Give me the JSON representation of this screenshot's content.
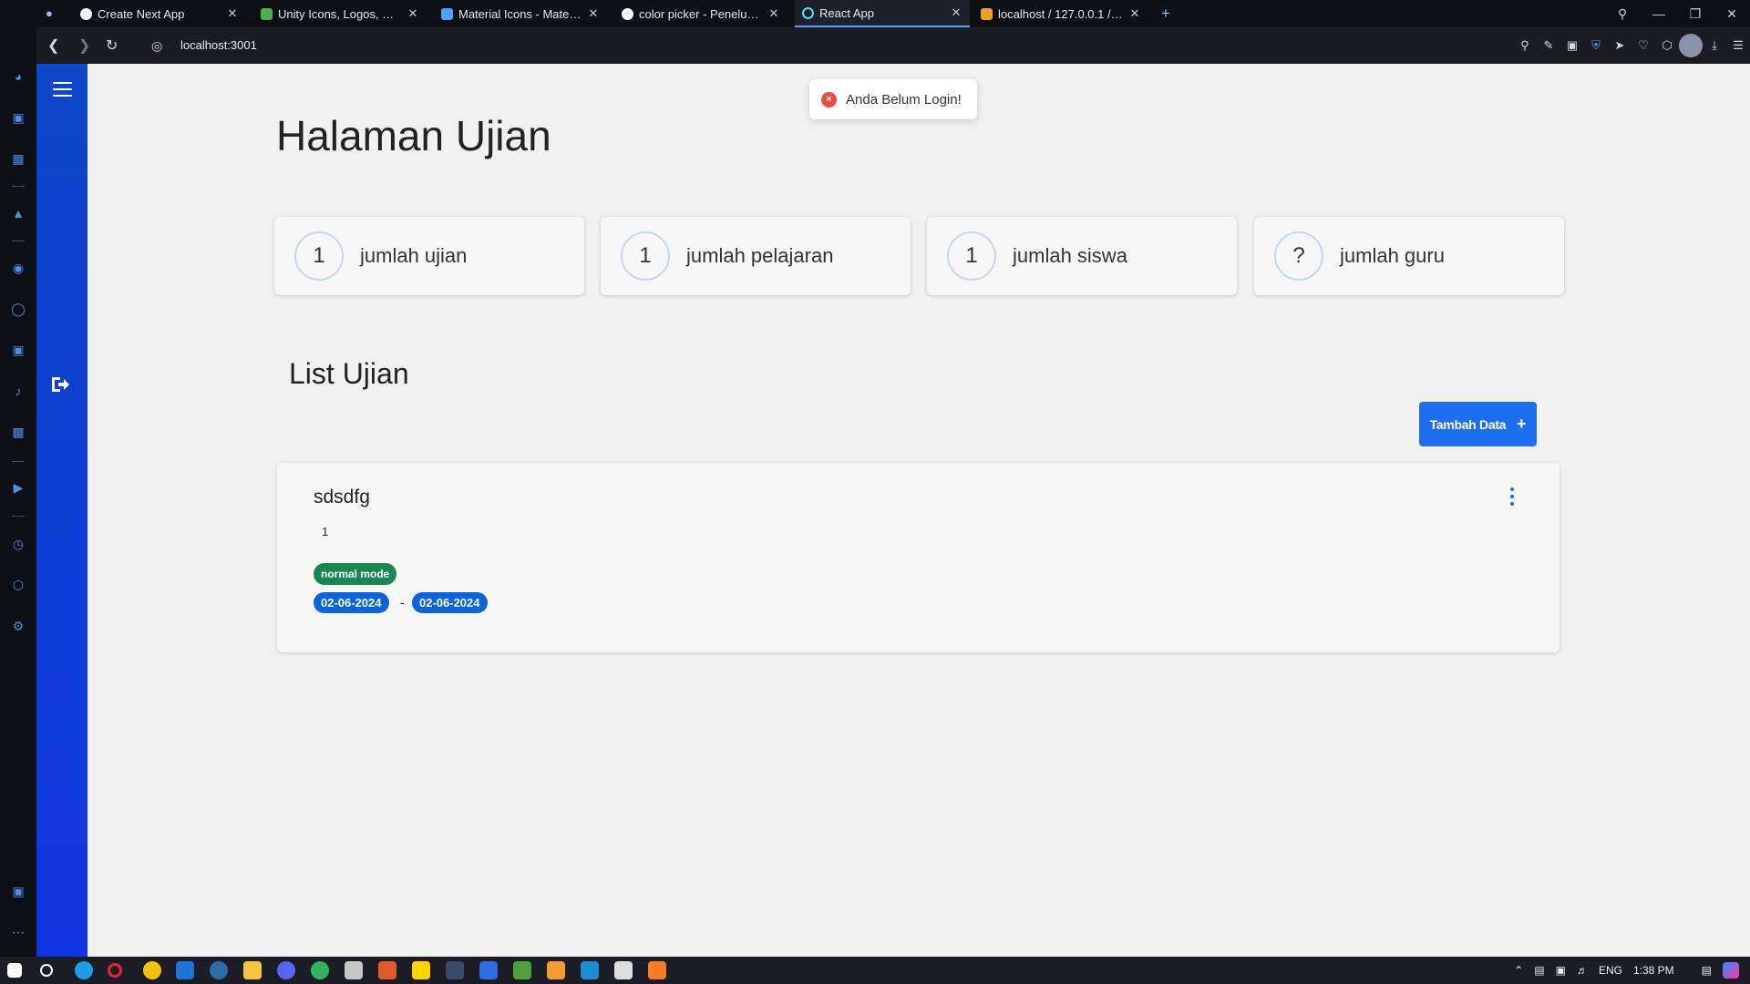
{
  "browser": {
    "tabs": [
      {
        "title": "Create Next App",
        "favicon_color": "#ffffff"
      },
      {
        "title": "Unity Icons, Logos, Symbol",
        "favicon_color": "#4caf50"
      },
      {
        "title": "Material Icons - Material UI",
        "favicon_color": "#4aa3ff"
      },
      {
        "title": "color picker - Penelusuran",
        "favicon_color": "#ffffff"
      },
      {
        "title": "React App",
        "favicon_color": "#61dafb",
        "active": true
      },
      {
        "title": "localhost / 127.0.0.1 / ujian",
        "favicon_color": "#f0a020"
      }
    ],
    "new_tab_icon": "+",
    "url": "localhost:3001"
  },
  "app": {
    "page_title": "Halaman Ujian",
    "stats": [
      {
        "value": "1",
        "label": "jumlah ujian"
      },
      {
        "value": "1",
        "label": "jumlah pelajaran"
      },
      {
        "value": "1",
        "label": "jumlah siswa"
      },
      {
        "value": "?",
        "label": "jumlah guru"
      }
    ],
    "list_title": "List Ujian",
    "add_button": "Tambah Data",
    "add_button_icon": "+",
    "exams": [
      {
        "name": "sdsdfg",
        "value": "1",
        "mode": "normal mode",
        "start_date": "02-06-2024",
        "separator": "-",
        "end_date": "02-06-2024"
      }
    ],
    "toast": {
      "icon": "×",
      "message": "Anda Belum Login!"
    }
  },
  "taskbar": {
    "lang": "ENG",
    "time": "1:38 PM"
  },
  "colors": {
    "sidebar_gradient_top": "#0d47c8",
    "sidebar_gradient_bottom": "#1035e0",
    "primary_button": "#1e6ff0",
    "badge_mode": "#198754",
    "badge_date": "#0d64d8",
    "toast_error": "#e74c3c"
  }
}
